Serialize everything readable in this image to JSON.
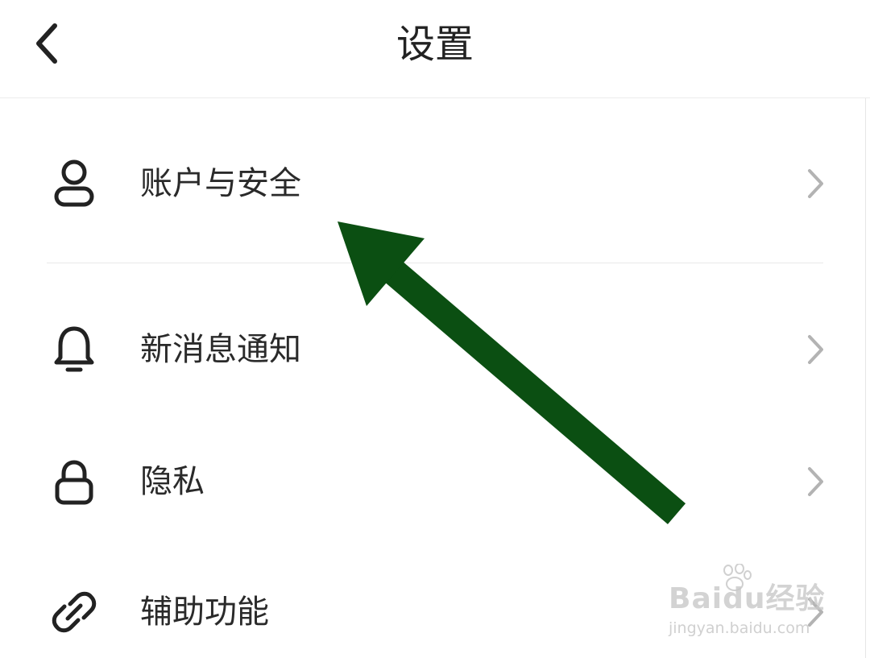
{
  "header": {
    "title": "设置",
    "back_icon": "chevron-left-icon"
  },
  "settings": {
    "items": [
      {
        "label": "账户与安全",
        "icon": "user-icon"
      },
      {
        "label": "新消息通知",
        "icon": "bell-icon"
      },
      {
        "label": "隐私",
        "icon": "lock-icon"
      },
      {
        "label": "辅助功能",
        "icon": "link-icon"
      }
    ]
  },
  "annotation": {
    "arrow_color": "#0b4f12",
    "points_to": "账户与安全"
  },
  "watermark": {
    "logo_text": "Baidu经验",
    "url_text": "jingyan.baidu.com"
  },
  "colors": {
    "chevron": "#b3b3b3",
    "icon": "#222222",
    "divider": "#e8e8e8"
  }
}
